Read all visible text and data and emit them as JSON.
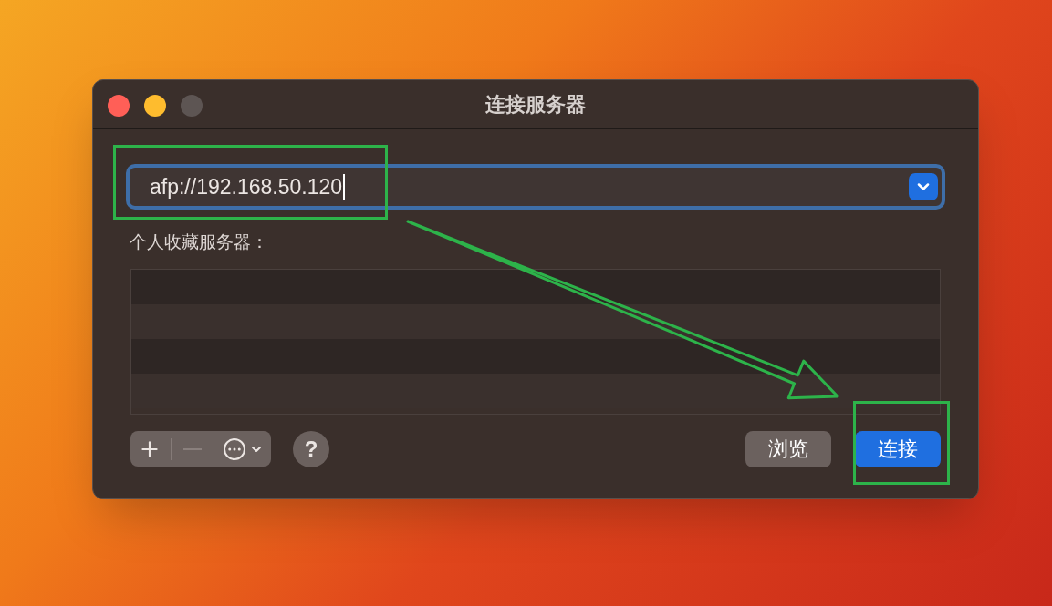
{
  "window": {
    "title": "连接服务器",
    "controls": [
      {
        "kind": "close",
        "disabled": false
      },
      {
        "kind": "minimize",
        "disabled": false
      },
      {
        "kind": "zoom",
        "disabled": true
      }
    ]
  },
  "address": {
    "value": "afp://192.168.50.120",
    "focused": true
  },
  "favorites": {
    "label": "个人收藏服务器："
  },
  "toolbar": [
    {
      "kind": "add",
      "disabled": false
    },
    {
      "kind": "remove",
      "disabled": true
    },
    {
      "kind": "more",
      "disabled": false
    }
  ],
  "help": {
    "label": "?"
  },
  "buttons": [
    {
      "label": "浏览",
      "kind": "secondary"
    },
    {
      "label": "连接",
      "kind": "primary"
    }
  ]
}
